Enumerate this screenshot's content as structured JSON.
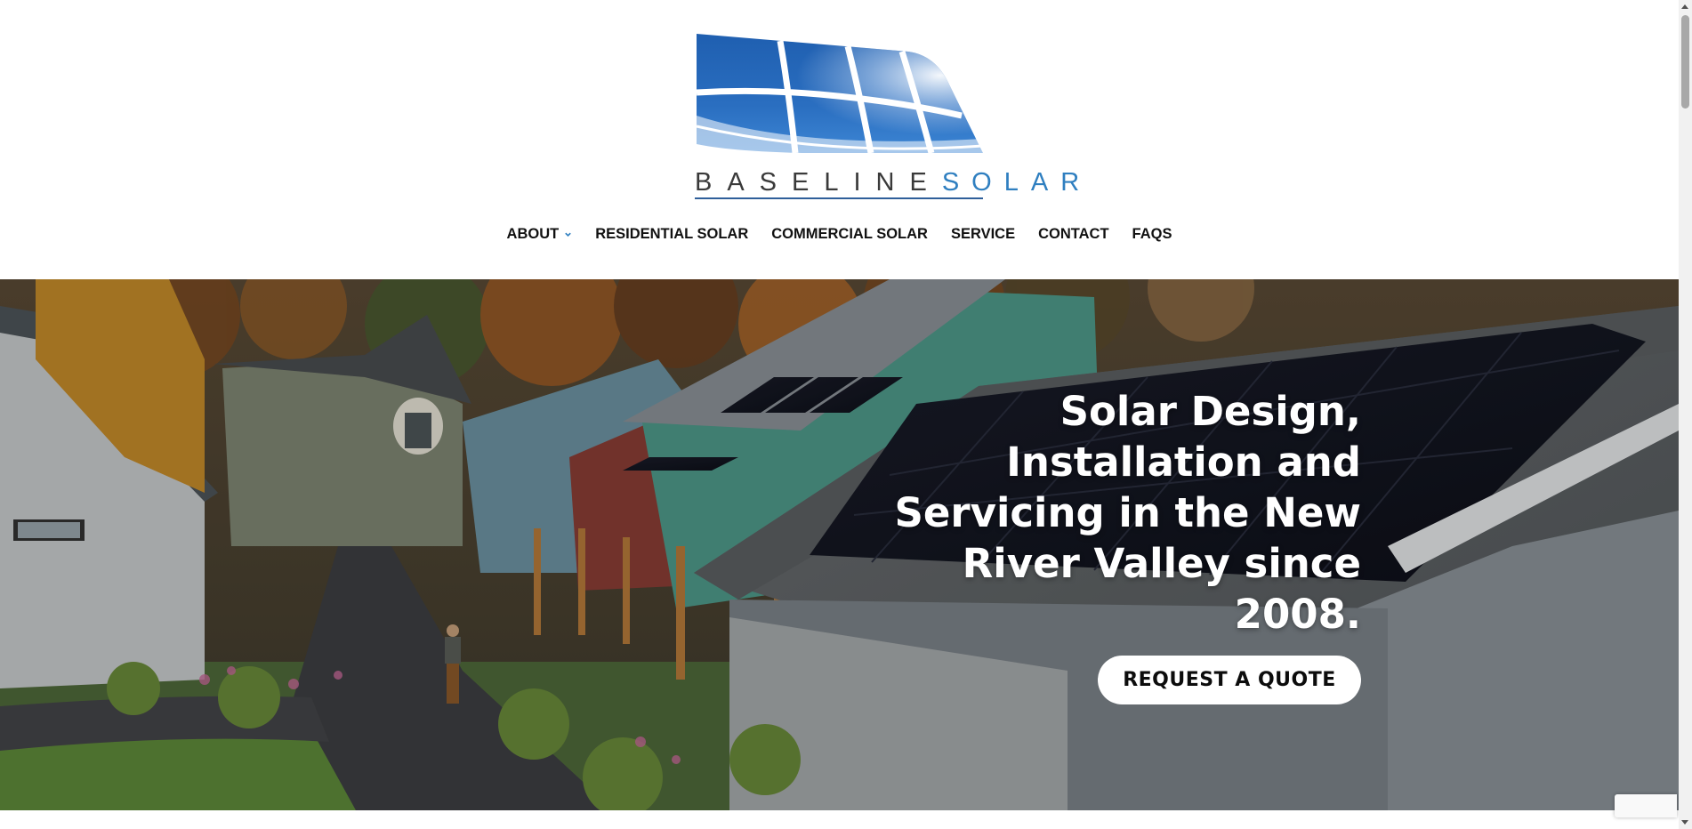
{
  "header": {
    "logo": {
      "wordmark_dark": "BASELINE",
      "wordmark_blue": "SOLAR",
      "alt": "Baseline Solar logo"
    },
    "nav": {
      "items": [
        {
          "label": "ABOUT",
          "has_dropdown": true
        },
        {
          "label": "RESIDENTIAL SOLAR"
        },
        {
          "label": "COMMERCIAL SOLAR"
        },
        {
          "label": "SERVICE"
        },
        {
          "label": "CONTACT"
        },
        {
          "label": "FAQS"
        }
      ]
    }
  },
  "hero": {
    "heading": "Solar Design, Installation and Servicing in the New River Valley since 2008.",
    "cta_label": "REQUEST A QUOTE"
  },
  "colors": {
    "brand_blue": "#2f7fc0",
    "nav_text": "#111111",
    "chevron": "#2f7fc0",
    "hero_text": "#ffffff",
    "cta_bg": "#ffffff"
  },
  "icons": {
    "nav_dropdown": "chevron-down-icon",
    "recaptcha": "recaptcha-badge"
  }
}
